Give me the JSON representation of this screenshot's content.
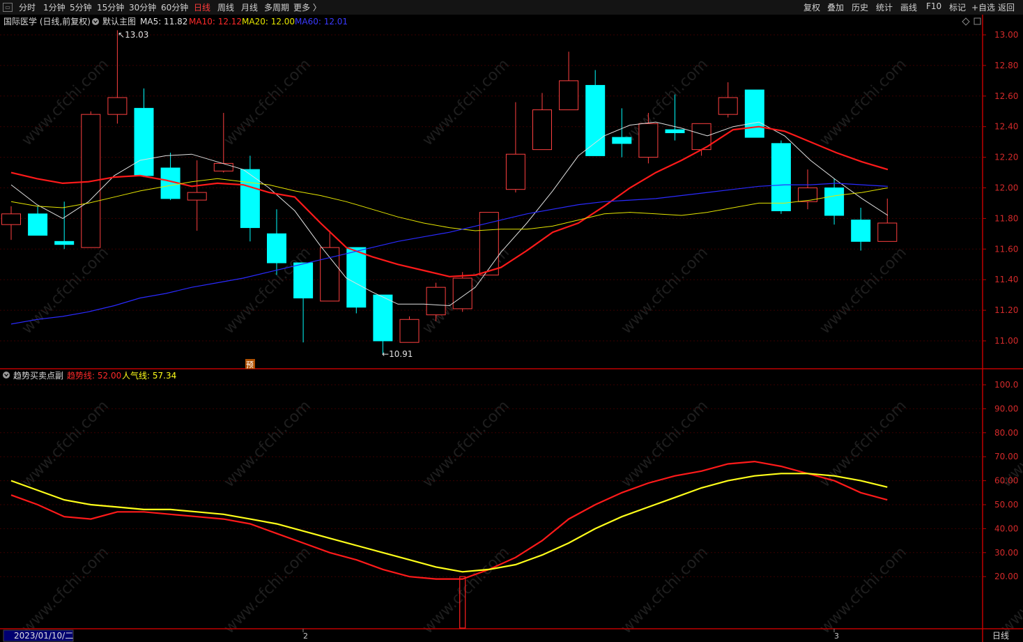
{
  "toolbar": {
    "periods": [
      {
        "label": "分时",
        "active": false
      },
      {
        "label": "1分钟",
        "active": false
      },
      {
        "label": "5分钟",
        "active": false
      },
      {
        "label": "15分钟",
        "active": false
      },
      {
        "label": "30分钟",
        "active": false
      },
      {
        "label": "60分钟",
        "active": false
      },
      {
        "label": "日线",
        "active": true
      },
      {
        "label": "周线",
        "active": false
      },
      {
        "label": "月线",
        "active": false
      },
      {
        "label": "多周期",
        "active": false
      },
      {
        "label": "更多 〉",
        "active": false
      }
    ],
    "actions": [
      "复权",
      "叠加",
      "历史",
      "统计",
      "画线",
      "F10",
      "标记",
      "+自选",
      "返回"
    ]
  },
  "main_legend": {
    "title": "国际医学 (日线,前复权)",
    "template": "默认主图",
    "ma5": "MA5: 11.82",
    "ma10": "MA10: 12.12",
    "ma20": "MA20: 12.00",
    "ma60": "MA60: 12.01"
  },
  "sub_legend": {
    "title": "趋势买卖点副",
    "trend": "趋势线: 52.00",
    "popularity": "人气线: 57.34"
  },
  "annotations": {
    "high": "13.03",
    "low": "10.91",
    "marker": "预"
  },
  "bottom_axis": {
    "date_box": "2023/01/10/二",
    "ticks": [
      "2",
      "3"
    ],
    "period": "日线"
  },
  "watermark": "www.cfchi.com",
  "colors": {
    "up": "#ff4040",
    "down": "#00ffff",
    "ma5": "#e0e0e0",
    "ma10": "#ff1a1a",
    "ma20": "#e6e600",
    "ma60": "#2a2aff",
    "trend": "#ff1a1a",
    "popularity": "#ffff1a",
    "axis": "#c00000"
  },
  "chart_data": [
    {
      "type": "candlestick",
      "title": "国际医学 (日线,前复权)",
      "y_ticks": [
        "13.00",
        "12.80",
        "12.60",
        "12.40",
        "12.20",
        "12.00",
        "11.80",
        "11.60",
        "11.40",
        "11.20",
        "11.00"
      ],
      "ylim": [
        10.82,
        13.18
      ],
      "candles": [
        {
          "o": 11.76,
          "h": 11.88,
          "l": 11.66,
          "c": 11.83
        },
        {
          "o": 11.83,
          "h": 11.88,
          "l": 11.69,
          "c": 11.69
        },
        {
          "o": 11.65,
          "h": 11.91,
          "l": 11.6,
          "c": 11.63
        },
        {
          "o": 11.61,
          "h": 12.5,
          "l": 11.61,
          "c": 12.48
        },
        {
          "o": 12.48,
          "h": 13.03,
          "l": 12.42,
          "c": 12.59
        },
        {
          "o": 12.52,
          "h": 12.65,
          "l": 12.07,
          "c": 12.08
        },
        {
          "o": 12.13,
          "h": 12.23,
          "l": 11.92,
          "c": 11.93
        },
        {
          "o": 11.92,
          "h": 12.18,
          "l": 11.72,
          "c": 11.97
        },
        {
          "o": 12.11,
          "h": 12.49,
          "l": 12.1,
          "c": 12.16
        },
        {
          "o": 12.12,
          "h": 12.21,
          "l": 11.65,
          "c": 11.74
        },
        {
          "o": 11.7,
          "h": 11.86,
          "l": 11.43,
          "c": 11.51
        },
        {
          "o": 11.51,
          "h": 11.51,
          "l": 10.99,
          "c": 11.28
        },
        {
          "o": 11.26,
          "h": 11.72,
          "l": 11.26,
          "c": 11.61
        },
        {
          "o": 11.61,
          "h": 11.61,
          "l": 11.18,
          "c": 11.22
        },
        {
          "o": 11.3,
          "h": 11.3,
          "l": 10.91,
          "c": 11.0
        },
        {
          "o": 10.99,
          "h": 11.16,
          "l": 10.99,
          "c": 11.14
        },
        {
          "o": 11.17,
          "h": 11.38,
          "l": 11.13,
          "c": 11.35
        },
        {
          "o": 11.21,
          "h": 11.45,
          "l": 11.19,
          "c": 11.41
        },
        {
          "o": 11.43,
          "h": 11.79,
          "l": 11.43,
          "c": 11.84
        },
        {
          "o": 11.99,
          "h": 12.56,
          "l": 11.97,
          "c": 12.22
        },
        {
          "o": 12.25,
          "h": 12.62,
          "l": 12.25,
          "c": 12.51
        },
        {
          "o": 12.51,
          "h": 12.89,
          "l": 12.51,
          "c": 12.7
        },
        {
          "o": 12.67,
          "h": 12.77,
          "l": 12.21,
          "c": 12.21
        },
        {
          "o": 12.33,
          "h": 12.52,
          "l": 12.2,
          "c": 12.29
        },
        {
          "o": 12.2,
          "h": 12.49,
          "l": 12.16,
          "c": 12.42
        },
        {
          "o": 12.38,
          "h": 12.61,
          "l": 12.31,
          "c": 12.36
        },
        {
          "o": 12.25,
          "h": 12.42,
          "l": 12.21,
          "c": 12.42
        },
        {
          "o": 12.48,
          "h": 12.69,
          "l": 12.46,
          "c": 12.59
        },
        {
          "o": 12.64,
          "h": 12.64,
          "l": 12.33,
          "c": 12.33
        },
        {
          "o": 12.29,
          "h": 12.31,
          "l": 11.83,
          "c": 11.85
        },
        {
          "o": 11.91,
          "h": 12.12,
          "l": 11.86,
          "c": 12.0
        },
        {
          "o": 12.0,
          "h": 12.06,
          "l": 11.76,
          "c": 11.82
        },
        {
          "o": 11.79,
          "h": 11.87,
          "l": 11.59,
          "c": 11.65
        },
        {
          "o": 11.65,
          "h": 11.93,
          "l": 11.65,
          "c": 11.77
        }
      ],
      "series": [
        {
          "name": "MA5",
          "values": [
            12.02,
            11.89,
            11.8,
            11.91,
            12.08,
            12.18,
            12.21,
            12.22,
            12.17,
            12.12,
            12.0,
            11.85,
            11.62,
            11.41,
            11.32,
            11.24,
            11.24,
            11.23,
            11.35,
            11.58,
            11.77,
            11.98,
            12.21,
            12.34,
            12.41,
            12.43,
            12.39,
            12.34,
            12.4,
            12.43,
            12.34,
            12.18,
            12.05,
            11.93,
            11.82
          ]
        },
        {
          "name": "MA10",
          "values": [
            12.1,
            12.06,
            12.03,
            12.04,
            12.07,
            12.08,
            12.05,
            12.01,
            12.03,
            12.02,
            11.97,
            11.94,
            11.77,
            11.61,
            11.55,
            11.5,
            11.46,
            11.42,
            11.43,
            11.48,
            11.59,
            11.71,
            11.77,
            11.88,
            12.0,
            12.1,
            12.18,
            12.27,
            12.38,
            12.4,
            12.37,
            12.3,
            12.23,
            12.17,
            12.12
          ]
        },
        {
          "name": "MA20",
          "values": [
            11.91,
            11.88,
            11.87,
            11.9,
            11.94,
            11.98,
            12.01,
            12.04,
            12.06,
            12.04,
            12.02,
            11.98,
            11.95,
            11.91,
            11.86,
            11.81,
            11.77,
            11.74,
            11.72,
            11.73,
            11.73,
            11.75,
            11.79,
            11.83,
            11.84,
            11.83,
            11.82,
            11.84,
            11.87,
            11.9,
            11.9,
            11.92,
            11.95,
            11.97,
            12.0
          ]
        },
        {
          "name": "MA60",
          "values": [
            11.11,
            11.14,
            11.16,
            11.19,
            11.23,
            11.28,
            11.31,
            11.35,
            11.38,
            11.41,
            11.45,
            11.49,
            11.53,
            11.57,
            11.61,
            11.65,
            11.68,
            11.71,
            11.75,
            11.79,
            11.83,
            11.86,
            11.89,
            11.91,
            11.92,
            11.93,
            11.95,
            11.97,
            11.99,
            12.01,
            12.02,
            12.02,
            12.03,
            12.02,
            12.01
          ]
        }
      ]
    },
    {
      "type": "line",
      "title": "趋势买卖点副",
      "y_ticks": [
        "100.0",
        "90.00",
        "80.00",
        "70.00",
        "60.00",
        "50.00",
        "40.00",
        "30.00",
        "20.00"
      ],
      "ylim": [
        10,
        105
      ],
      "series": [
        {
          "name": "趋势线",
          "values": [
            54,
            50,
            45,
            44,
            47,
            47,
            46,
            45,
            44,
            42,
            38,
            34,
            30,
            27,
            23,
            20,
            19,
            19,
            23,
            28,
            35,
            44,
            50,
            55,
            59,
            62,
            64,
            67,
            68,
            66,
            63,
            60,
            55,
            52
          ]
        },
        {
          "name": "人气线",
          "values": [
            60,
            56,
            52,
            50,
            49,
            48,
            48,
            47,
            46,
            44,
            42,
            39,
            36,
            33,
            30,
            27,
            24,
            22,
            23,
            25,
            29,
            34,
            40,
            45,
            49,
            53,
            57,
            60,
            62,
            63,
            63,
            62,
            60,
            57.34
          ]
        }
      ],
      "bar": {
        "index": 17,
        "from": 20,
        "to": 0
      }
    }
  ]
}
